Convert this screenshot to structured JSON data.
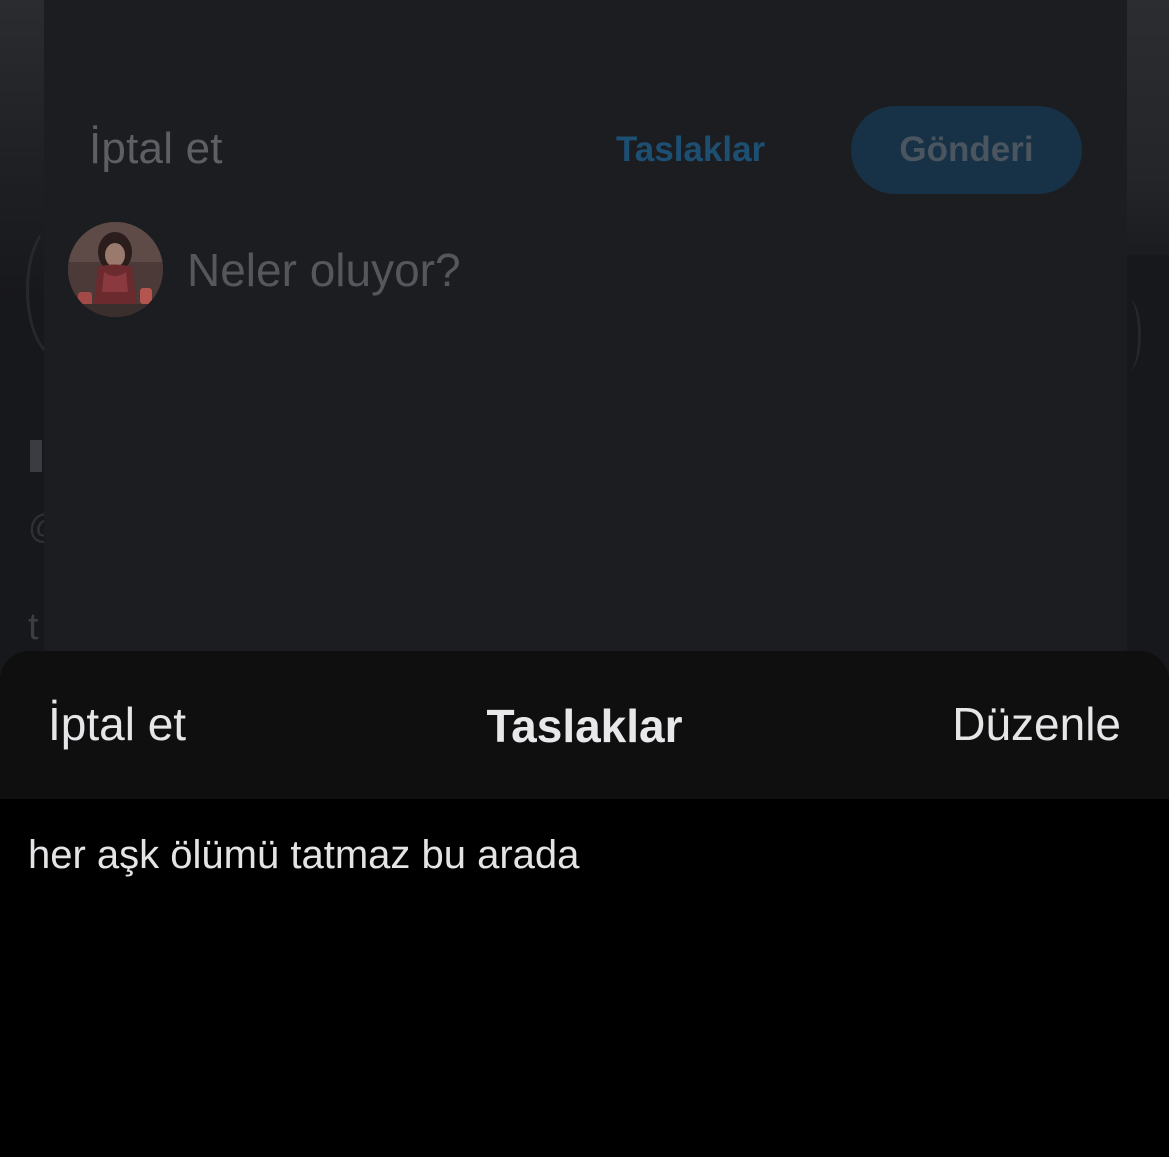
{
  "composer": {
    "cancel_label": "İptal et",
    "drafts_label": "Taslaklar",
    "post_label": "Gönderi",
    "placeholder": "Neler oluyor?"
  },
  "background": {
    "glyph_text": "t"
  },
  "drafts_sheet": {
    "cancel_label": "İptal et",
    "title": "Taslaklar",
    "edit_label": "Düzenle",
    "items": [
      {
        "text": "her aşk ölümü tatmaz bu arada"
      }
    ]
  },
  "colors": {
    "accent_blue": "#1d9bf0",
    "sheet_background": "#000000"
  }
}
